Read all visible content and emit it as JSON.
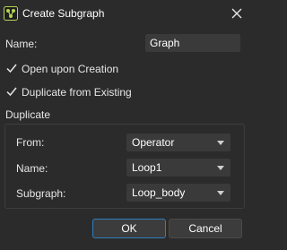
{
  "window": {
    "title": "Create Subgraph",
    "app_icon": "node-graph-icon",
    "close_icon": "close-icon"
  },
  "form": {
    "name_label": "Name:",
    "name_value": "Graph",
    "open_upon_creation": {
      "label": "Open upon Creation",
      "checked": true
    },
    "duplicate_from_existing": {
      "label": "Duplicate from Existing",
      "checked": true
    },
    "duplicate_section_label": "Duplicate",
    "duplicate": {
      "from": {
        "label": "From:",
        "value": "Operator"
      },
      "name": {
        "label": "Name:",
        "value": "Loop1"
      },
      "subgraph": {
        "label": "Subgraph:",
        "value": "Loop_body"
      }
    }
  },
  "buttons": {
    "ok_label": "OK",
    "cancel_label": "Cancel"
  },
  "colors": {
    "background": "#2b2b2b",
    "field": "#3a3a3a",
    "accent": "#2f7fbf",
    "app_icon_green": "#b4d455"
  }
}
